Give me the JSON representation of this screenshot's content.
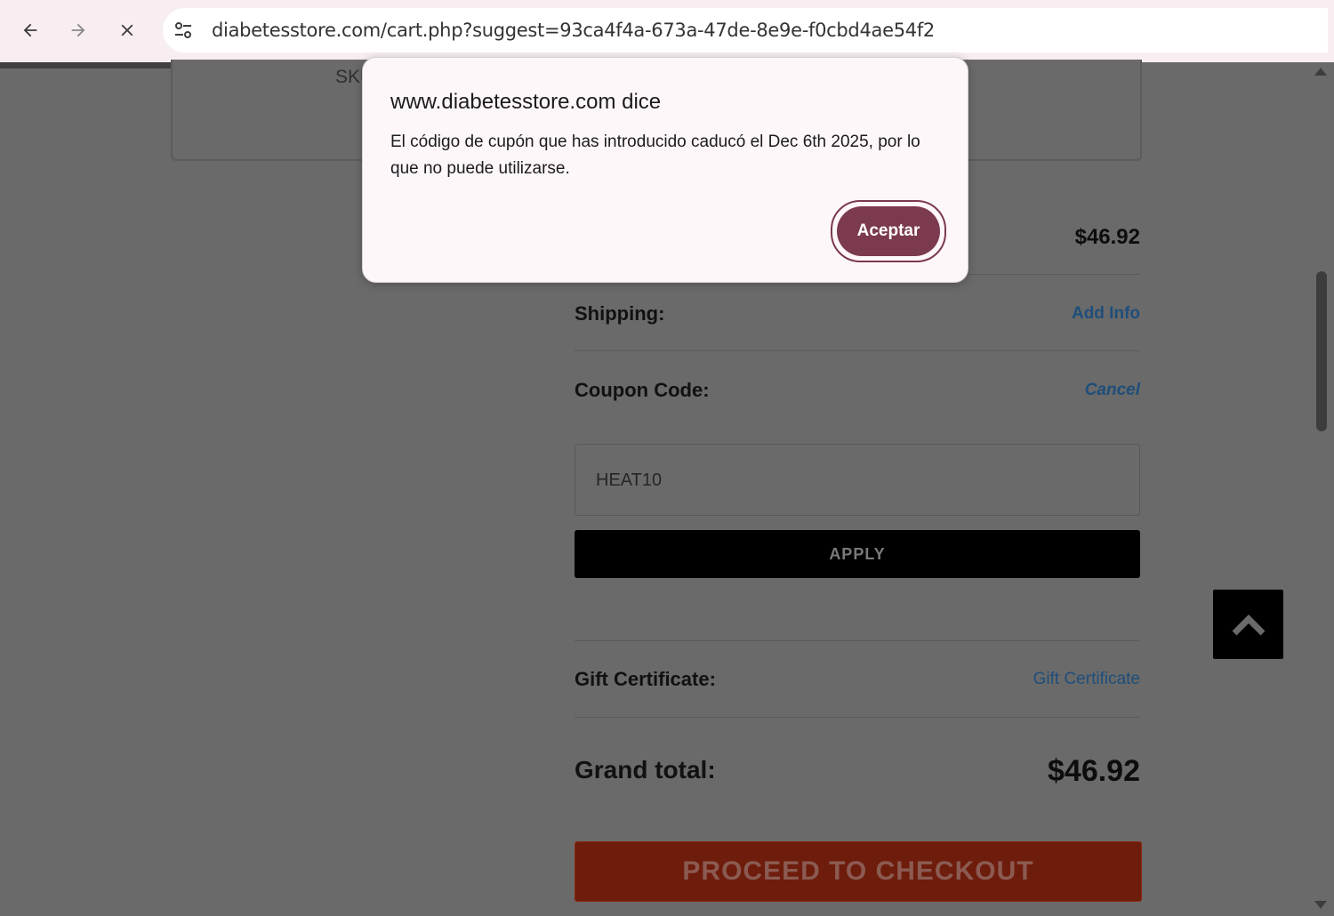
{
  "browser": {
    "url": "diabetesstore.com/cart.php?suggest=93ca4f4a-673a-47de-8e9e-f0cbd4ae54f2",
    "back_icon": "arrow-left-icon",
    "forward_icon": "arrow-right-icon",
    "stop_icon": "close-icon",
    "site_info_icon": "tune-icon"
  },
  "cart": {
    "sku_label": "SKU",
    "subtotal_value": "$46.92",
    "shipping_label": "Shipping:",
    "shipping_link": "Add Info",
    "coupon_label": "Coupon Code:",
    "coupon_cancel": "Cancel",
    "coupon_value": "HEAT10",
    "apply_label": "APPLY",
    "gift_label": "Gift Certificate:",
    "gift_link": "Gift Certificate",
    "grand_total_label": "Grand total:",
    "grand_total_value": "$46.92",
    "checkout_label": "PROCEED TO CHECKOUT"
  },
  "dialog": {
    "title": "www.diabetesstore.com dice",
    "message": "El código de cupón que has introducido caducó el Dec 6th 2025, por lo que no puede utilizarse.",
    "accept_label": "Aceptar"
  },
  "colors": {
    "overlay": "#6a6a6a",
    "dialog_accent": "#7b3a4d",
    "link": "#1f4e7a",
    "checkout": "#6e1c0c"
  }
}
